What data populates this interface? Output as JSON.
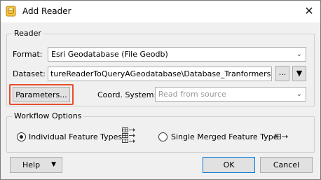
{
  "window": {
    "title": "Add Reader"
  },
  "icons": {
    "app": "reader-icon",
    "close": "close-icon"
  },
  "reader": {
    "group_label": "Reader",
    "format_label": "Format:",
    "format_value": "Esri Geodatabase (File Geodb)",
    "dataset_label": "Dataset:",
    "dataset_value": "tureReaderToQueryAGeodatabase\\Database_Tranformers.gdb\"",
    "browse_label": "...",
    "parameters_label": "Parameters...",
    "coord_label": "Coord. System:",
    "coord_placeholder": "Read from source"
  },
  "workflow": {
    "group_label": "Workflow Options",
    "individual_label": "Individual Feature Types",
    "merged_label": "Single Merged Feature Type",
    "selected": "individual"
  },
  "footer": {
    "help_label": "Help",
    "ok_label": "OK",
    "cancel_label": "Cancel"
  },
  "colors": {
    "highlight": "#e74c2c",
    "accent": "#0078d7"
  }
}
